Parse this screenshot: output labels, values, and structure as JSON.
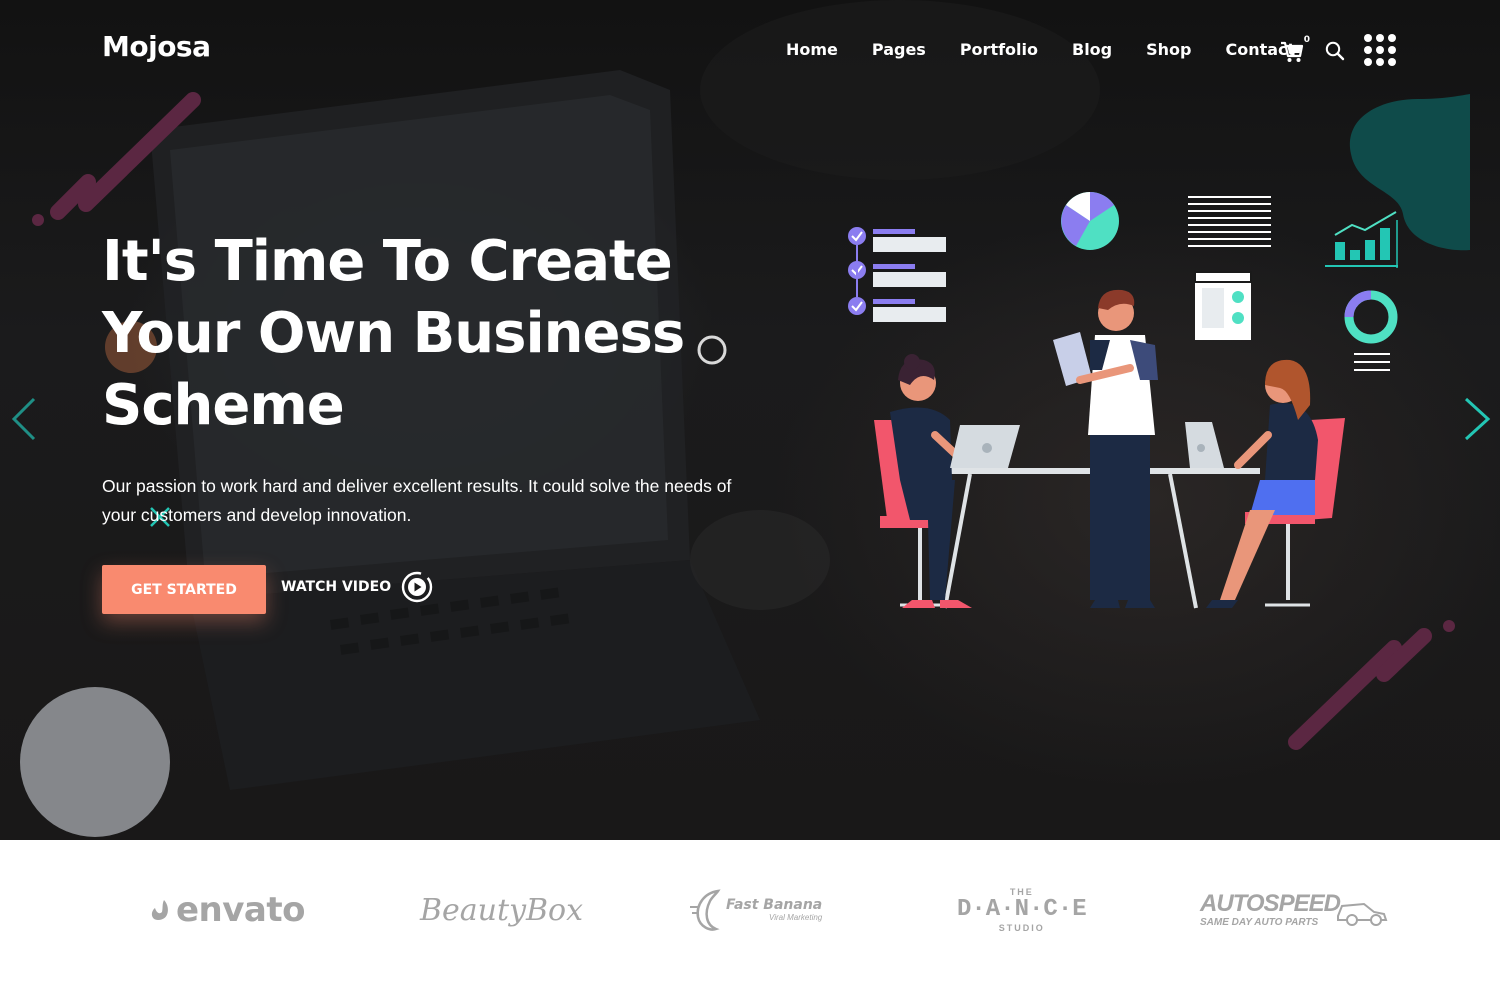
{
  "header": {
    "logo": "Mojosa",
    "nav": [
      "Home",
      "Pages",
      "Portfolio",
      "Blog",
      "Shop",
      "Contact"
    ],
    "cart_count": "0",
    "icons": [
      "cart-icon",
      "search-icon",
      "grid-menu-icon"
    ]
  },
  "hero": {
    "headline_lines": [
      "It's Time To Create",
      "Your Own Business",
      "Scheme"
    ],
    "description": "Our passion to work hard and deliver excellent results. It could solve the needs of your customers and develop innovation.",
    "primary_button": "GET STARTED",
    "secondary_button": "WATCH VIDEO",
    "slider_arrows": [
      "chevron-left-icon",
      "chevron-right-icon"
    ]
  },
  "brands": {
    "envato": "envato",
    "beautybox": "BeautyBox",
    "fastbanana": "Fast Banana",
    "fastbanana_tagline": "Viral Marketing",
    "dance_top": "THE",
    "dance_main": "D·A·N·C·E",
    "dance_bottom": "STUDIO",
    "autospeed": "AUTOSPEED",
    "autospeed_tagline": "SAME DAY AUTO PARTS"
  },
  "colors": {
    "accent": "#f98a6f",
    "teal": "#23c6b4",
    "purple": "#8b7df0",
    "plum": "#5b2742",
    "dark_teal": "#0f4b4a"
  }
}
